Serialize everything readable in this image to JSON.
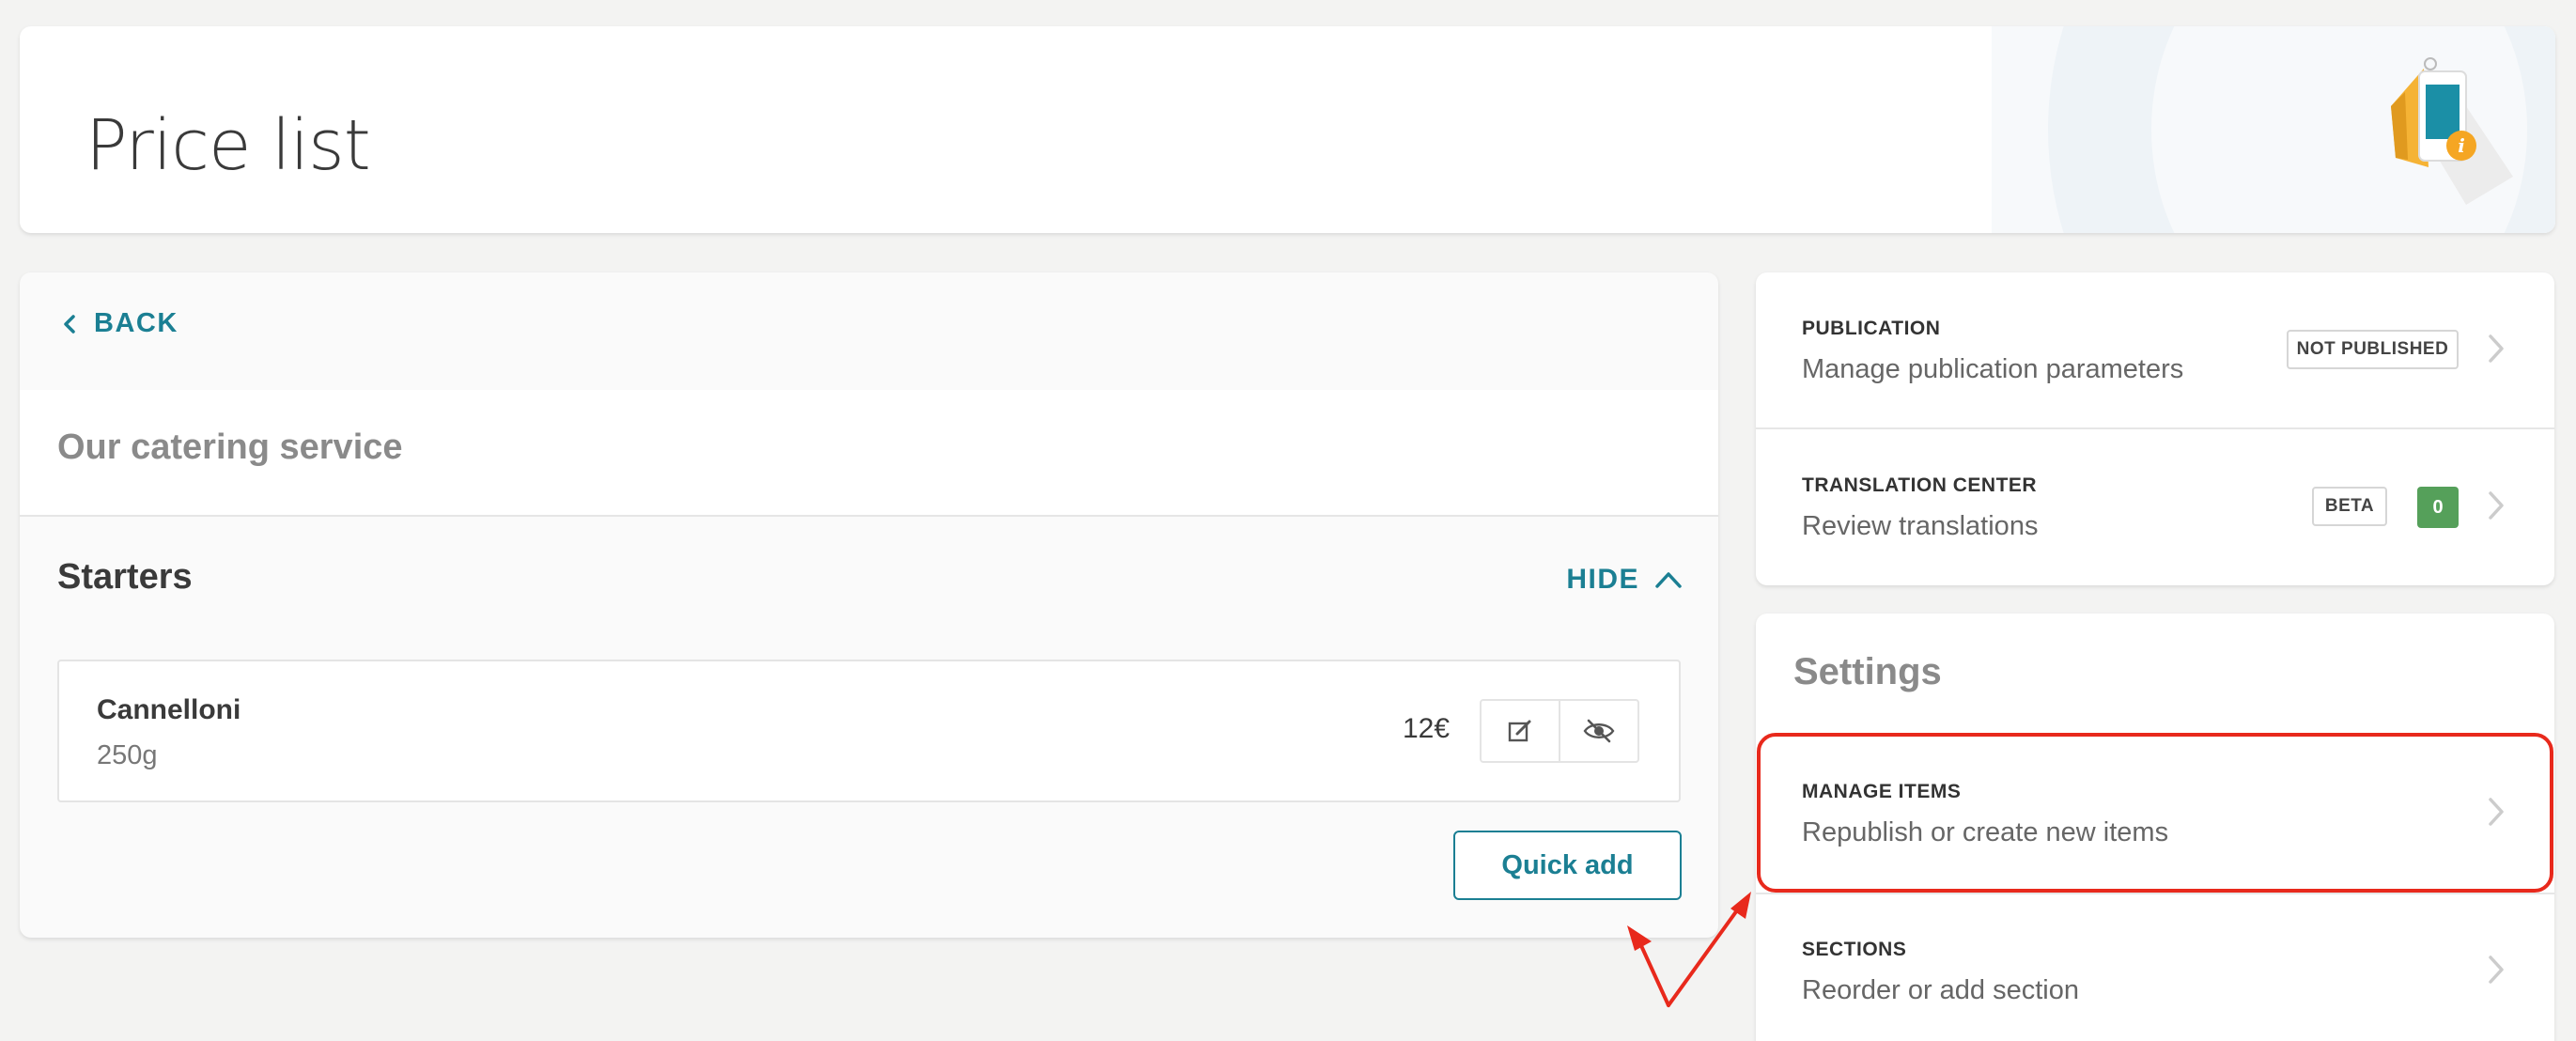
{
  "header": {
    "title": "Price list",
    "illustration": "price-tag-info-icon"
  },
  "main": {
    "back_label": "BACK",
    "catering_title": "Our catering service",
    "section": {
      "title": "Starters",
      "toggle_label": "HIDE",
      "items": [
        {
          "name": "Cannelloni",
          "weight": "250g",
          "price": "12€"
        }
      ],
      "quick_add_label": "Quick add"
    }
  },
  "publication": {
    "label": "PUBLICATION",
    "description": "Manage publication parameters",
    "status": "NOT PUBLISHED"
  },
  "translation": {
    "label": "TRANSLATION CENTER",
    "description": "Review translations",
    "beta": "BETA",
    "count": "0"
  },
  "settings": {
    "title": "Settings",
    "manage_items": {
      "label": "MANAGE ITEMS",
      "description": "Republish or create new items"
    },
    "sections": {
      "label": "SECTIONS",
      "description": "Reorder or add section"
    }
  },
  "colors": {
    "accent": "#1b7f93",
    "highlight": "#e8291c",
    "count_badge": "#55a05a",
    "background": "#f3f3f2"
  }
}
